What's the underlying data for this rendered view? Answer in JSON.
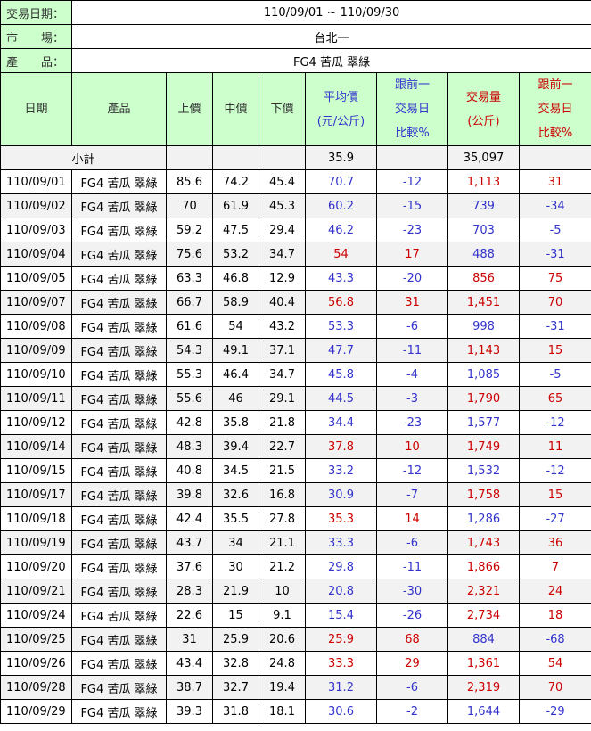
{
  "info": {
    "date_label": "交易日期：",
    "date_value": "110/09/01 ~ 110/09/30",
    "market_label": "市　　場：",
    "market_value": "台北一",
    "product_label": "產　　品：",
    "product_value": "FG4 苦瓜 翠綠"
  },
  "headers": {
    "date": "日期",
    "product": "產品",
    "high": "上價",
    "mid": "中價",
    "low": "下價",
    "avg_l1": "平均價",
    "avg_l2": "(元/公斤)",
    "cmp1_l1": "跟前一",
    "cmp1_l2": "交易日",
    "cmp1_l3": "比較%",
    "vol_l1": "交易量",
    "vol_l2": "(公斤)",
    "cmp2_l1": "跟前一",
    "cmp2_l2": "交易日",
    "cmp2_l3": "比較%"
  },
  "subtotal": {
    "label": "小計",
    "avg": "35.9",
    "vol": "35,097"
  },
  "colors": {
    "up": "#cc0000",
    "down": "#3333cc",
    "header_bg": "#ccffcc"
  },
  "rows": [
    {
      "date": "110/09/01",
      "product": "FG4 苦瓜 翠綠",
      "high": "85.6",
      "mid": "74.2",
      "low": "45.4",
      "avg": "70.7",
      "avg_cmp": "-12",
      "vol": "1,113",
      "vol_cmp": "31"
    },
    {
      "date": "110/09/02",
      "product": "FG4 苦瓜 翠綠",
      "high": "70",
      "mid": "61.9",
      "low": "45.3",
      "avg": "60.2",
      "avg_cmp": "-15",
      "vol": "739",
      "vol_cmp": "-34"
    },
    {
      "date": "110/09/03",
      "product": "FG4 苦瓜 翠綠",
      "high": "59.2",
      "mid": "47.5",
      "low": "29.4",
      "avg": "46.2",
      "avg_cmp": "-23",
      "vol": "703",
      "vol_cmp": "-5"
    },
    {
      "date": "110/09/04",
      "product": "FG4 苦瓜 翠綠",
      "high": "75.6",
      "mid": "53.2",
      "low": "34.7",
      "avg": "54",
      "avg_cmp": "17",
      "vol": "488",
      "vol_cmp": "-31"
    },
    {
      "date": "110/09/05",
      "product": "FG4 苦瓜 翠綠",
      "high": "63.3",
      "mid": "46.8",
      "low": "12.9",
      "avg": "43.3",
      "avg_cmp": "-20",
      "vol": "856",
      "vol_cmp": "75"
    },
    {
      "date": "110/09/07",
      "product": "FG4 苦瓜 翠綠",
      "high": "66.7",
      "mid": "58.9",
      "low": "40.4",
      "avg": "56.8",
      "avg_cmp": "31",
      "vol": "1,451",
      "vol_cmp": "70"
    },
    {
      "date": "110/09/08",
      "product": "FG4 苦瓜 翠綠",
      "high": "61.6",
      "mid": "54",
      "low": "43.2",
      "avg": "53.3",
      "avg_cmp": "-6",
      "vol": "998",
      "vol_cmp": "-31"
    },
    {
      "date": "110/09/09",
      "product": "FG4 苦瓜 翠綠",
      "high": "54.3",
      "mid": "49.1",
      "low": "37.1",
      "avg": "47.7",
      "avg_cmp": "-11",
      "vol": "1,143",
      "vol_cmp": "15"
    },
    {
      "date": "110/09/10",
      "product": "FG4 苦瓜 翠綠",
      "high": "55.3",
      "mid": "46.4",
      "low": "34.7",
      "avg": "45.8",
      "avg_cmp": "-4",
      "vol": "1,085",
      "vol_cmp": "-5"
    },
    {
      "date": "110/09/11",
      "product": "FG4 苦瓜 翠綠",
      "high": "55.6",
      "mid": "46",
      "low": "29.1",
      "avg": "44.5",
      "avg_cmp": "-3",
      "vol": "1,790",
      "vol_cmp": "65"
    },
    {
      "date": "110/09/12",
      "product": "FG4 苦瓜 翠綠",
      "high": "42.8",
      "mid": "35.8",
      "low": "21.8",
      "avg": "34.4",
      "avg_cmp": "-23",
      "vol": "1,577",
      "vol_cmp": "-12"
    },
    {
      "date": "110/09/14",
      "product": "FG4 苦瓜 翠綠",
      "high": "48.3",
      "mid": "39.4",
      "low": "22.7",
      "avg": "37.8",
      "avg_cmp": "10",
      "vol": "1,749",
      "vol_cmp": "11"
    },
    {
      "date": "110/09/15",
      "product": "FG4 苦瓜 翠綠",
      "high": "40.8",
      "mid": "34.5",
      "low": "21.5",
      "avg": "33.2",
      "avg_cmp": "-12",
      "vol": "1,532",
      "vol_cmp": "-12"
    },
    {
      "date": "110/09/17",
      "product": "FG4 苦瓜 翠綠",
      "high": "39.8",
      "mid": "32.6",
      "low": "16.8",
      "avg": "30.9",
      "avg_cmp": "-7",
      "vol": "1,758",
      "vol_cmp": "15"
    },
    {
      "date": "110/09/18",
      "product": "FG4 苦瓜 翠綠",
      "high": "42.4",
      "mid": "35.5",
      "low": "27.8",
      "avg": "35.3",
      "avg_cmp": "14",
      "vol": "1,286",
      "vol_cmp": "-27"
    },
    {
      "date": "110/09/19",
      "product": "FG4 苦瓜 翠綠",
      "high": "43.7",
      "mid": "34",
      "low": "21.1",
      "avg": "33.3",
      "avg_cmp": "-6",
      "vol": "1,743",
      "vol_cmp": "36"
    },
    {
      "date": "110/09/20",
      "product": "FG4 苦瓜 翠綠",
      "high": "37.6",
      "mid": "30",
      "low": "21.2",
      "avg": "29.8",
      "avg_cmp": "-11",
      "vol": "1,866",
      "vol_cmp": "7"
    },
    {
      "date": "110/09/21",
      "product": "FG4 苦瓜 翠綠",
      "high": "28.3",
      "mid": "21.9",
      "low": "10",
      "avg": "20.8",
      "avg_cmp": "-30",
      "vol": "2,321",
      "vol_cmp": "24"
    },
    {
      "date": "110/09/24",
      "product": "FG4 苦瓜 翠綠",
      "high": "22.6",
      "mid": "15",
      "low": "9.1",
      "avg": "15.4",
      "avg_cmp": "-26",
      "vol": "2,734",
      "vol_cmp": "18"
    },
    {
      "date": "110/09/25",
      "product": "FG4 苦瓜 翠綠",
      "high": "31",
      "mid": "25.9",
      "low": "20.6",
      "avg": "25.9",
      "avg_cmp": "68",
      "vol": "884",
      "vol_cmp": "-68"
    },
    {
      "date": "110/09/26",
      "product": "FG4 苦瓜 翠綠",
      "high": "43.4",
      "mid": "32.8",
      "low": "24.8",
      "avg": "33.3",
      "avg_cmp": "29",
      "vol": "1,361",
      "vol_cmp": "54"
    },
    {
      "date": "110/09/28",
      "product": "FG4 苦瓜 翠綠",
      "high": "38.7",
      "mid": "32.7",
      "low": "19.4",
      "avg": "31.2",
      "avg_cmp": "-6",
      "vol": "2,319",
      "vol_cmp": "70"
    },
    {
      "date": "110/09/29",
      "product": "FG4 苦瓜 翠綠",
      "high": "39.3",
      "mid": "31.8",
      "low": "18.1",
      "avg": "30.6",
      "avg_cmp": "-2",
      "vol": "1,644",
      "vol_cmp": "-29"
    }
  ]
}
